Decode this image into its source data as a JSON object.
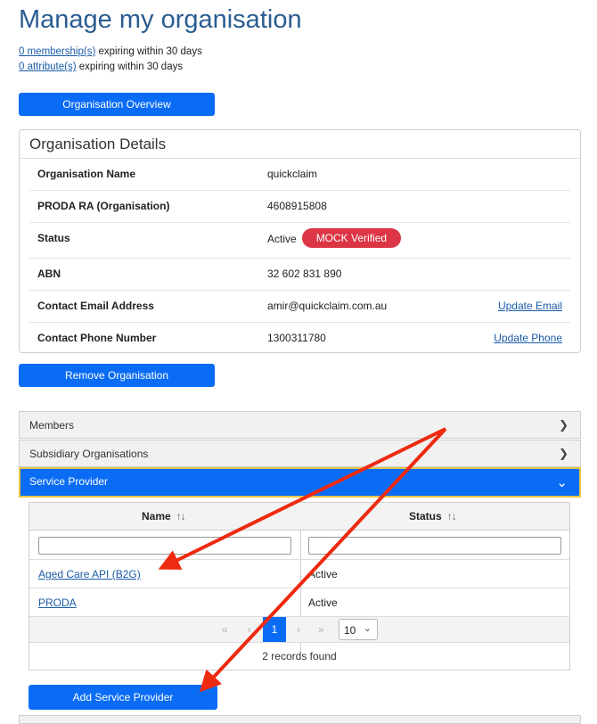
{
  "page": {
    "title": "Manage my organisation"
  },
  "expiry": {
    "memberships_link": "0 membership(s)",
    "memberships_text": " expiring within 30 days",
    "attributes_link": "0 attribute(s)",
    "attributes_text": " expiring within 30 days"
  },
  "buttons": {
    "overview": "Organisation Overview",
    "remove": "Remove Organisation",
    "add_service_provider": "Add Service Provider"
  },
  "details": {
    "title": "Organisation Details",
    "rows": [
      {
        "label": "Organisation Name",
        "value": "quickclaim"
      },
      {
        "label": "PRODA RA (Organisation)",
        "value": "4608915808"
      },
      {
        "label": "Status",
        "value": "Active",
        "badge": "MOCK Verified"
      },
      {
        "label": "ABN",
        "value": "32 602 831 890"
      },
      {
        "label": "Contact Email Address",
        "value": "amir@quickclaim.com.au",
        "action": "Update Email"
      },
      {
        "label": "Contact Phone Number",
        "value": "1300311780",
        "action": "Update Phone"
      }
    ]
  },
  "accordion": {
    "members": "Members",
    "subsidiaries": "Subsidiary Organisations",
    "service_provider": "Service Provider"
  },
  "service_table": {
    "columns": [
      "Name",
      "Status"
    ],
    "sort_icon": "↑↓",
    "rows": [
      {
        "name": "Aged Care API (B2G)",
        "status": "Active"
      },
      {
        "name": "PRODA",
        "status": "Active"
      }
    ],
    "pagination": {
      "first": "«",
      "prev": "‹",
      "current": "1",
      "next": "›",
      "last": "»",
      "page_size": "10"
    },
    "records_found": "2 records found"
  },
  "colors": {
    "primary": "#0a6cf5",
    "badge_red": "#dc3545",
    "title_blue": "#2a5d91",
    "arrow_red": "#ee2a10",
    "focus_yellow": "#e8c547"
  },
  "icons": {
    "accordion_collapsed": "chevron-right-icon",
    "accordion_expanded": "chevron-down-icon",
    "sort": "sort-icon"
  }
}
